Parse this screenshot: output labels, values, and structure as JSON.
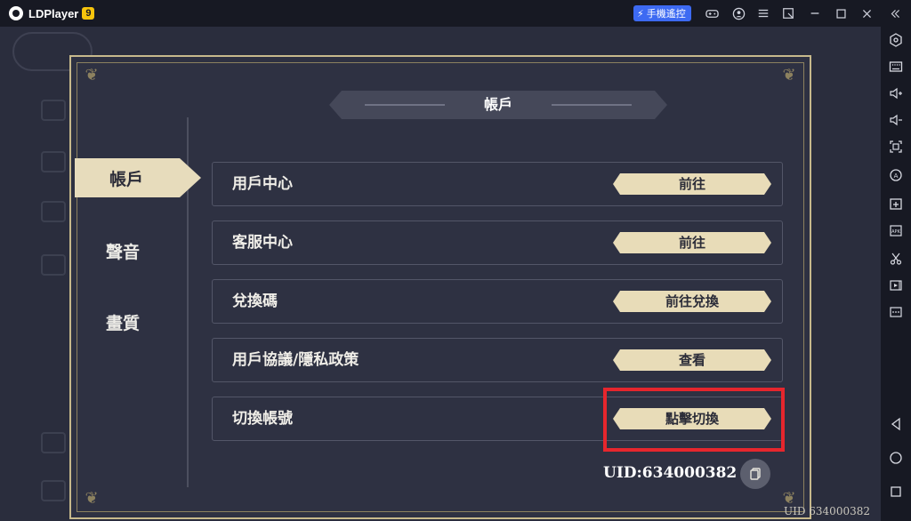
{
  "emulator": {
    "app_name": "LDPlayer",
    "version": "9",
    "remote_label": "手機遙控"
  },
  "game": {
    "modal_title": "帳戶",
    "tabs": [
      {
        "label": "帳戶",
        "active": true
      },
      {
        "label": "聲音",
        "active": false
      },
      {
        "label": "畫質",
        "active": false
      }
    ],
    "rows": [
      {
        "label": "用戶中心",
        "button": "前往"
      },
      {
        "label": "客服中心",
        "button": "前往"
      },
      {
        "label": "兌換碼",
        "button": "前往兌換"
      },
      {
        "label": "用戶協議/隱私政策",
        "button": "查看"
      },
      {
        "label": "切換帳號",
        "button": "點擊切換"
      }
    ],
    "uid_label": "UID:634000382",
    "uid_footer": "UID 634000382"
  },
  "colors": {
    "highlight": "#e6262d",
    "button_bg": "#e8dcb8",
    "frame_gold": "#c7b98c",
    "remote_blue": "#3d6af2"
  }
}
